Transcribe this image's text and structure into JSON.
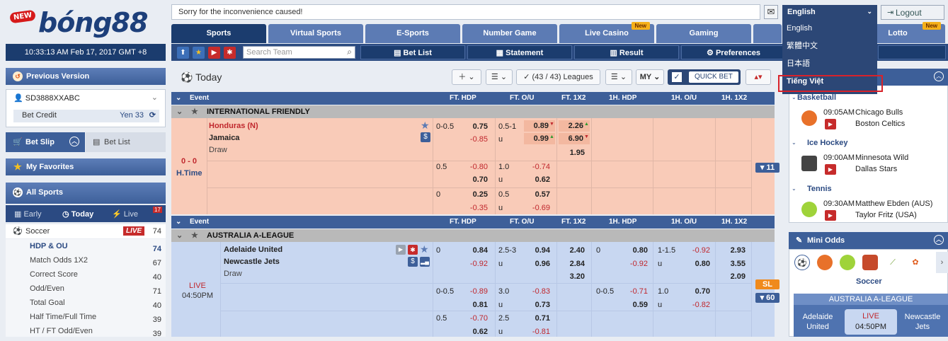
{
  "header": {
    "logo_badge": "NEW",
    "logo_text": "bóng88",
    "notice": "Sorry for the inconvenience caused!",
    "language": "English",
    "logout": "Logout"
  },
  "tabs": [
    {
      "label": "Sports"
    },
    {
      "label": "Virtual Sports"
    },
    {
      "label": "E-Sports"
    },
    {
      "label": "Number Game"
    },
    {
      "label": "Live Casino",
      "badge": "New"
    },
    {
      "label": "Gaming"
    },
    {
      "label": "Lotto",
      "badge": "New"
    }
  ],
  "clock": "10:33:13 AM Feb 17, 2017 GMT +8",
  "search_placeholder": "Search Team",
  "toolbar": {
    "bet_list": "Bet List",
    "statement": "Statement",
    "result": "Result",
    "preferences": "Preferences"
  },
  "language_menu": [
    "English",
    "繁體中文",
    "日本語",
    "Tiếng Việt"
  ],
  "sidebar": {
    "previous_version": "Previous Version",
    "user_id": "SD3888XXABC",
    "bet_credit_label": "Bet Credit",
    "bet_credit_value": "Yen 33",
    "bet_slip": "Bet Slip",
    "bet_list": "Bet List",
    "my_favorites": "My Favorites",
    "all_sports": "All Sports",
    "time_tabs": {
      "early": "Early",
      "today": "Today",
      "live": "Live",
      "live_count": "17"
    },
    "soccer": {
      "label": "Soccer",
      "live_badge": "LIVE",
      "count": "74"
    },
    "sub_items": [
      {
        "label": "HDP & OU",
        "count": "74"
      },
      {
        "label": "Match Odds 1X2",
        "count": "67"
      },
      {
        "label": "Correct Score",
        "count": "40"
      },
      {
        "label": "Odd/Even",
        "count": "71"
      },
      {
        "label": "Total Goal",
        "count": "40"
      },
      {
        "label": "Half Time/Full Time",
        "count": "39"
      },
      {
        "label": "HT / FT Odd/Even",
        "count": "39"
      }
    ]
  },
  "main": {
    "title": "Today",
    "leagues_filter": "(43 / 43) Leagues",
    "odds_type": "MY",
    "quick_bet": "QUICK BET",
    "columns": {
      "event": "Event",
      "ft_hdp": "FT. HDP",
      "ft_ou": "FT. O/U",
      "ft_1x2": "FT. 1X2",
      "h1_hdp": "1H. HDP",
      "h1_ou": "1H. O/U",
      "h1_1x2": "1H. 1X2"
    },
    "match1": {
      "league": "INTERNATIONAL FRIENDLY",
      "score": "0 - 0",
      "status": "H.Time",
      "home": "Honduras (N)",
      "away": "Jamaica",
      "draw": "Draw",
      "more": "▾ 11",
      "r1": {
        "hdp": "0-0.5",
        "h": "0.75",
        "a": "-0.85",
        "ou": "0.5-1",
        "o": "0.89",
        "u": "0.99",
        "uu": "u",
        "x1": "2.26",
        "x2": "6.90",
        "xd": "1.95"
      },
      "r2": {
        "hdp": "0.5",
        "h": "-0.80",
        "a": "0.70",
        "ou": "1.0",
        "o": "-0.74",
        "u": "0.62",
        "uu": "u"
      },
      "r3": {
        "hdp": "0",
        "h": "0.25",
        "a": "-0.35",
        "ou": "0.5",
        "o": "0.57",
        "u": "-0.69",
        "uu": "u"
      }
    },
    "match2": {
      "league": "AUSTRALIA A-LEAGUE",
      "status": "LIVE",
      "time": "04:50PM",
      "home": "Adelaide United",
      "away": "Newcastle Jets",
      "draw": "Draw",
      "sl": "SL",
      "more": "▾ 60",
      "r1": {
        "hdp": "0",
        "h": "0.84",
        "a": "-0.92",
        "ou": "2.5-3",
        "o": "0.94",
        "u": "0.96",
        "uu": "u",
        "x1": "2.40",
        "x2": "2.84",
        "xd": "3.20",
        "h1hdp": "0",
        "h1h": "0.80",
        "h1a": "-0.92",
        "h1ou": "1-1.5",
        "h1o": "-0.92",
        "h1u": "0.80",
        "h1uu": "u",
        "h1x1": "2.93",
        "h1x2": "3.55",
        "h1xd": "2.09"
      },
      "r2": {
        "hdp": "0-0.5",
        "h": "-0.89",
        "a": "0.81",
        "ou": "3.0",
        "o": "-0.83",
        "u": "0.73",
        "uu": "u",
        "h1hdp": "0-0.5",
        "h1h": "-0.71",
        "h1a": "0.59",
        "h1ou": "1.0",
        "h1o": "0.70",
        "h1u": "-0.82",
        "h1uu": "u"
      },
      "r3": {
        "hdp": "0.5",
        "h": "-0.70",
        "a": "0.62",
        "ou": "2.5",
        "o": "0.71",
        "u": "-0.81",
        "uu": "u"
      }
    }
  },
  "right": {
    "events": [
      {
        "sport": "Basketball",
        "time": "09:05AM",
        "home": "Chicago Bulls",
        "away": "Boston Celtics"
      },
      {
        "sport": "Ice Hockey",
        "time": "09:00AM",
        "home": "Minnesota Wild",
        "away": "Dallas Stars"
      },
      {
        "sport": "Tennis",
        "time": "09:30AM",
        "home": "Matthew Ebden (AUS)",
        "away": "Taylor Fritz (USA)"
      }
    ],
    "mini_odds": "Mini Odds",
    "mini_sport": "Soccer",
    "mini_league": "AUSTRALIA A-LEAGUE",
    "mini_home": "Adelaide United",
    "mini_status": "LIVE",
    "mini_time": "04:50PM",
    "mini_away": "Newcastle Jets"
  },
  "colors": {
    "navy": "#1b3c6e",
    "tab": "#5c7bb4",
    "live_red": "#c0272d",
    "peach": "#f9cbb8",
    "blue_row": "#c8d7f1",
    "highlight": "#d8222a"
  }
}
